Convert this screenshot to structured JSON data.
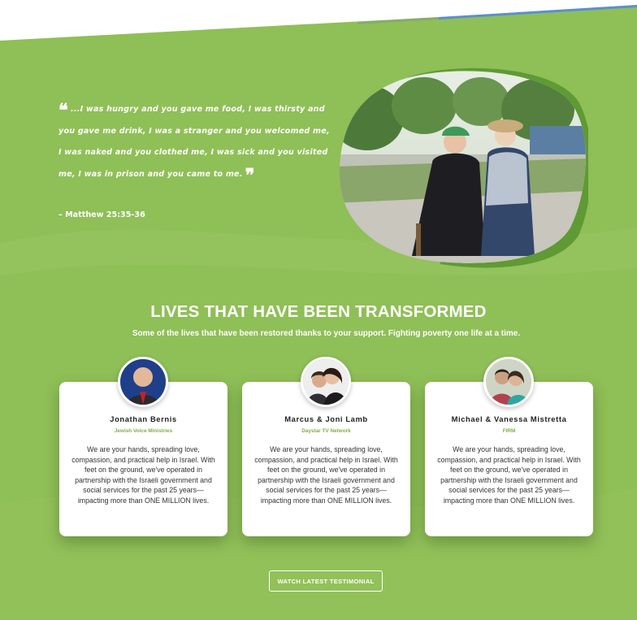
{
  "colors": {
    "background": "#8fbf57",
    "accent_green": "#7fae45",
    "accent_blue": "#4f86c6",
    "card": "#ffffff"
  },
  "quote": {
    "text": "...I was hungry and you gave me food, I was thirsty and you gave me drink, I was a stranger and you welcomed me, I was naked and you clothed me, I was sick and you visited me, I was in prison and you came to me.",
    "reference": "– Matthew 25:35-36",
    "open_icon": "quote-open-icon",
    "close_icon": "quote-close-icon"
  },
  "section": {
    "title": "LIVES THAT HAVE BEEN TRANSFORMED",
    "subtitle": "Some of the lives that have been restored thanks to your support. Fighting poverty one life at a time."
  },
  "testimonials": [
    {
      "name": "Jonathan Bernis",
      "org": "Jewish Voice Ministries",
      "body": "We are your hands, spreading love, compassion, and practical help in Israel. With feet on the ground, we've operated in partnership with the Israeli government and social services for the past 25 years—impacting more than ONE MILLION lives."
    },
    {
      "name": "Marcus & Joni Lamb",
      "org": "Daystar TV Network",
      "body": "We are your hands, spreading love, compassion, and practical help in Israel. With feet on the ground, we've operated in partnership with the Israeli government and social services for the past 25 years—impacting more than ONE MILLION lives."
    },
    {
      "name": "Michael & Vanessa Mistretta",
      "org": "FIRM",
      "body": "We are your hands, spreading love, compassion, and practical help in Israel. With feet on the ground, we've operated in partnership with the Israeli government and social services for the past 25 years—impacting more than ONE MILLION lives."
    }
  ],
  "cta": {
    "watch_label": "WATCH LATEST TESTIMONIAL"
  }
}
